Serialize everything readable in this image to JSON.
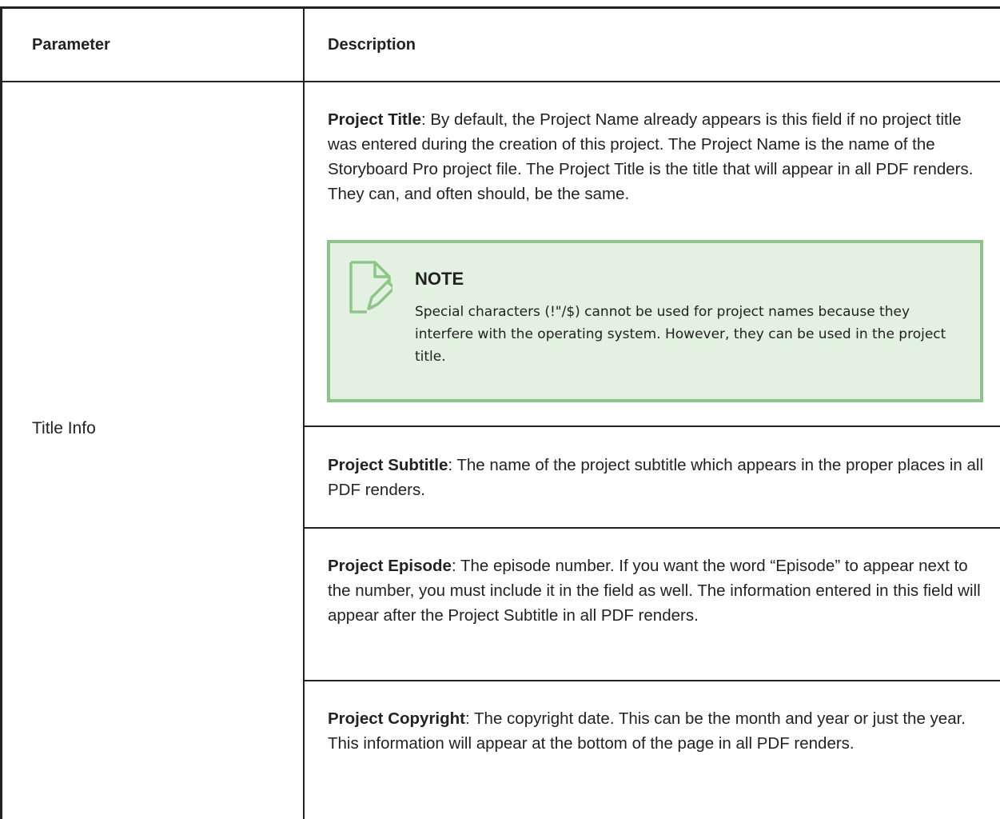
{
  "table": {
    "header": {
      "parameter": "Parameter",
      "description": "Description"
    },
    "row": {
      "parameter": "Title Info",
      "items": [
        {
          "term": "Project Title",
          "text": ": By default, the Project Name already appears is this field if no project title was entered during the creation of this project. The Project Name is the name of the Storyboard Pro project file. The Project Title is the title that will appear in all PDF renders. They can, and often should, be the same."
        },
        {
          "term": "Project Subtitle",
          "text": ": The name of the project subtitle which appears in the proper places in all PDF renders."
        },
        {
          "term": "Project Episode",
          "text": ": The episode number. If you want the word “Episode” to appear next to the number, you must include it in the field as well. The information entered in this field will appear after the Project Subtitle in all PDF renders."
        },
        {
          "term": "Project Copyright",
          "text": ": The copyright date. This can be the month and year or just the year. This information will appear at the bottom of the page in all PDF renders."
        }
      ]
    }
  },
  "note": {
    "icon": "note-edit-icon",
    "title": "NOTE",
    "text": "Special characters (!\"/$) cannot be used for project names because they interfere with the operating system. However, they can be used in the project title."
  },
  "colors": {
    "note_background": "#e3f1e0",
    "note_border": "#8fc58d",
    "rule": "#222222"
  }
}
